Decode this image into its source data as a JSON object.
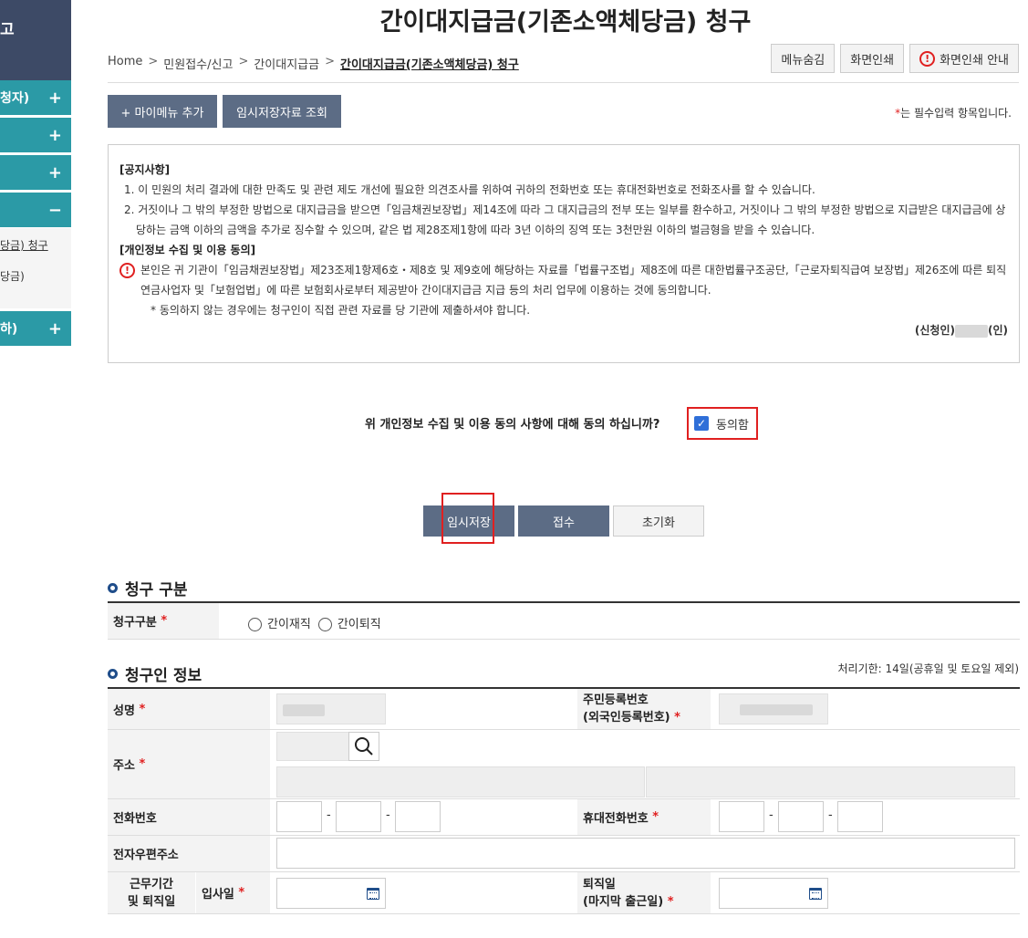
{
  "sidebar": {
    "head_fragment": "고",
    "items": [
      {
        "label": "청자)",
        "sign": "+"
      },
      {
        "label": "",
        "sign": "+"
      },
      {
        "label": "",
        "sign": "+"
      },
      {
        "label": "",
        "sign": "−"
      },
      {
        "label": "하)",
        "sign": "+"
      }
    ],
    "subitems": [
      "당금) 청구",
      "당금)"
    ]
  },
  "page": {
    "title": "간이대지급금(기존소액체당금) 청구"
  },
  "breadcrumb": {
    "items": [
      "Home",
      "민원접수/신고",
      "간이대지급금",
      "간이대지급금(기존소액체당금) 청구"
    ],
    "separator": ">"
  },
  "toolbar": {
    "hide_menu": "메뉴숨김",
    "print": "화면인쇄",
    "print_guide": "화면인쇄 안내",
    "warn_glyph": "!"
  },
  "actions_top": {
    "add_my_menu": "+ 마이메뉴 추가",
    "temp_lookup": "임시저장자료 조회",
    "required_mark": "*",
    "required_note": "는 필수입력 항목입니다."
  },
  "notice": {
    "head": "[공지사항]",
    "items": [
      "1. 이 민원의 처리 결과에 대한 만족도 및 관련 제도 개선에 필요한 의견조사를 위하여 귀하의 전화번호 또는 휴대전화번호로 전화조사를 할 수 있습니다.",
      "2. 거짓이나 그 밖의 부정한 방법으로 대지급금을 받으면「임금채권보장법」제14조에 따라 그 대지급금의 전부 또는 일부를 환수하고, 거짓이나 그 밖의 부정한 방법으로 지급받은 대지급금에 상당하는 금액 이하의 금액을 추가로 징수할 수 있으며, 같은 법 제28조제1항에 따라 3년 이하의 징역 또는 3천만원 이하의 벌금형을 받을 수 있습니다."
    ],
    "privacy_head": "[개인정보 수집 및 이용 동의]",
    "privacy_text": "본인은 귀 기관이「임금채권보장법」제23조제1항제6호・제8호 및 제9호에 해당하는 자료를「법률구조법」제8조에 따른 대한법률구조공단,「근로자퇴직급여 보장법」제26조에 따른 퇴직연금사업자 및「보험업법」에 따른 보험회사로부터 제공받아 간이대지급금 지급 등의 처리 업무에 이용하는 것에 동의합니다.",
    "note": "* 동의하지 않는 경우에는 청구인이 직접 관련 자료를 당 기관에 제출하셔야 합니다.",
    "sign_prefix": "(신청인)",
    "sign_suffix": "(인)"
  },
  "consent": {
    "question": "위 개인정보 수집 및 이용 동의 사항에 대해 동의 하십니까?",
    "agree_label": "동의함",
    "checked": true,
    "check_glyph": "✓"
  },
  "actions": {
    "temp_save": "임시저장",
    "submit": "접수",
    "reset": "초기화"
  },
  "section_claim": {
    "title": "청구 구분",
    "label": "청구구분",
    "options": [
      "간이재직",
      "간이퇴직"
    ]
  },
  "section_claimant": {
    "title": "청구인 정보",
    "deadline": "처리기한: 14일(공휴일 및 토요일 제외)",
    "name_label": "성명",
    "rrn_label_1": "주민등록번호",
    "rrn_label_2": "(외국인등록번호)",
    "address_label": "주소",
    "phone_label": "전화번호",
    "mobile_label": "휴대전화번호",
    "email_label": "전자우편주소",
    "period_label_1": "근무기간",
    "period_label_2": "및 퇴직일",
    "hire_label": "입사일",
    "retire_label_1": "퇴직일",
    "retire_label_2": "(마지막 출근일)",
    "dash": "-"
  },
  "colors": {
    "sidebar_head": "#3d4a66",
    "sidebar_item": "#2b9aa6",
    "dark_button": "#5c6c85",
    "highlight": "#e02020",
    "checkbox": "#2f6fd8"
  }
}
